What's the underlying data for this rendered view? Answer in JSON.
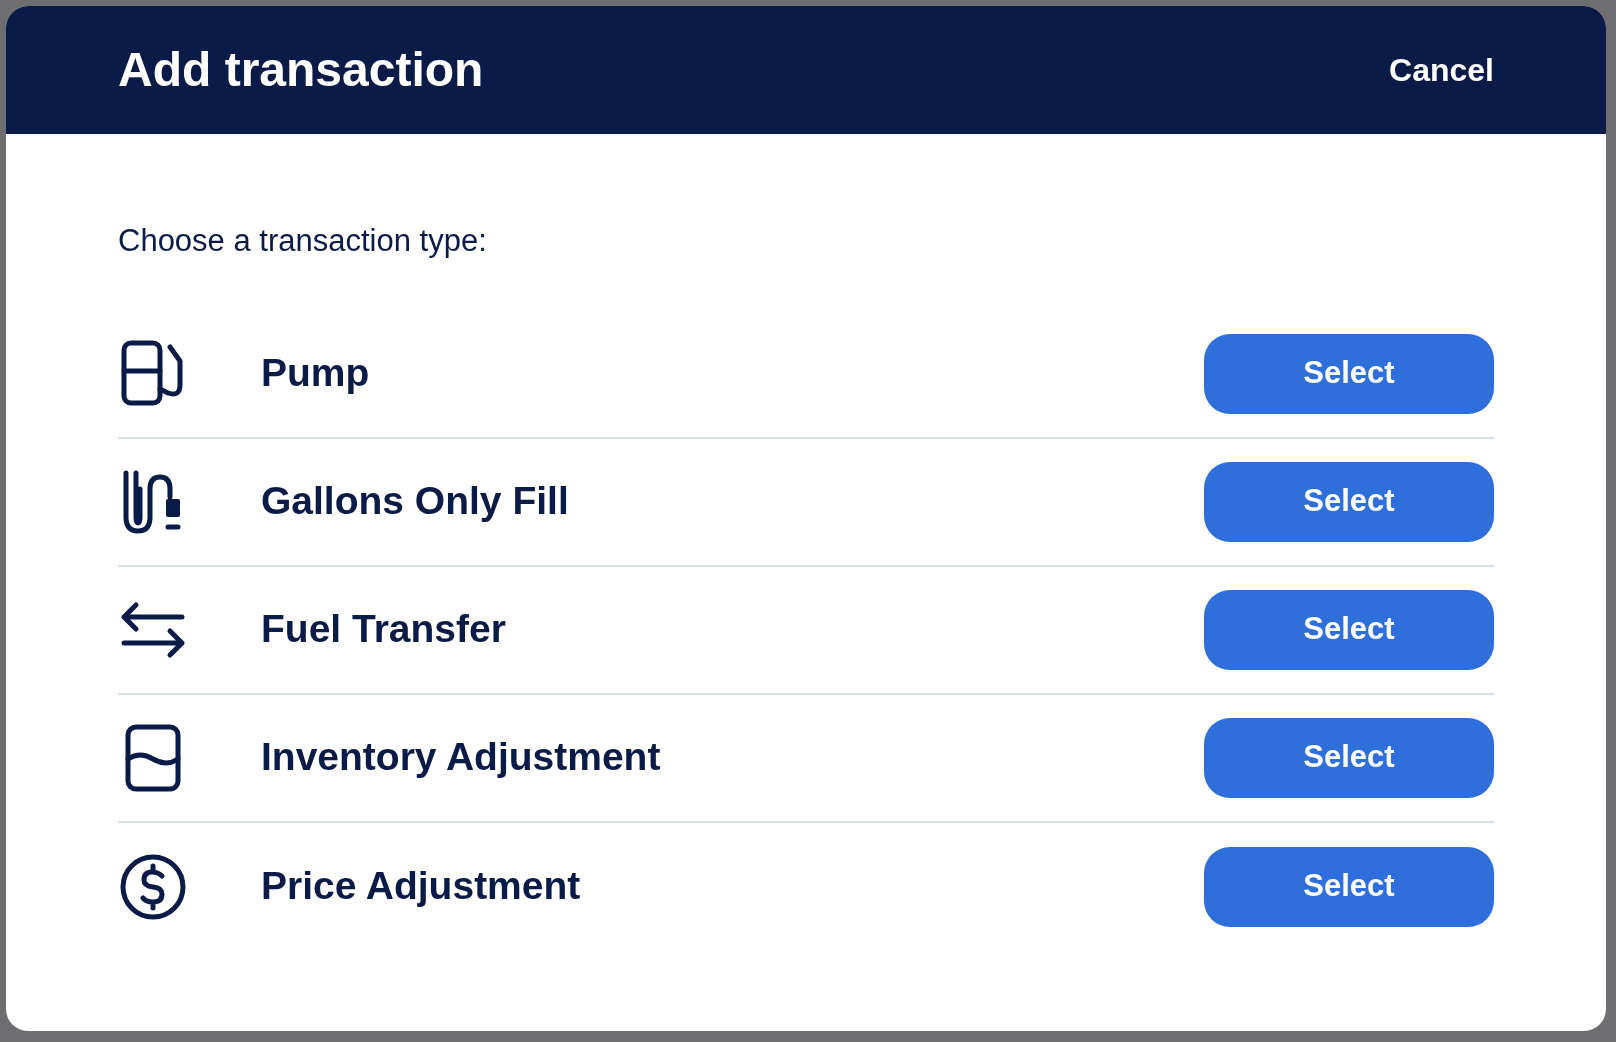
{
  "dialog": {
    "title": "Add transaction",
    "cancel": "Cancel",
    "prompt": "Choose a transaction type:",
    "options": [
      {
        "kind": "pump",
        "label": "Pump",
        "button": "Select"
      },
      {
        "kind": "hose",
        "label": "Gallons Only Fill",
        "button": "Select"
      },
      {
        "kind": "transfer",
        "label": "Fuel Transfer",
        "button": "Select"
      },
      {
        "kind": "tank",
        "label": "Inventory Adjustment",
        "button": "Select"
      },
      {
        "kind": "dollar",
        "label": "Price Adjustment",
        "button": "Select"
      }
    ]
  }
}
